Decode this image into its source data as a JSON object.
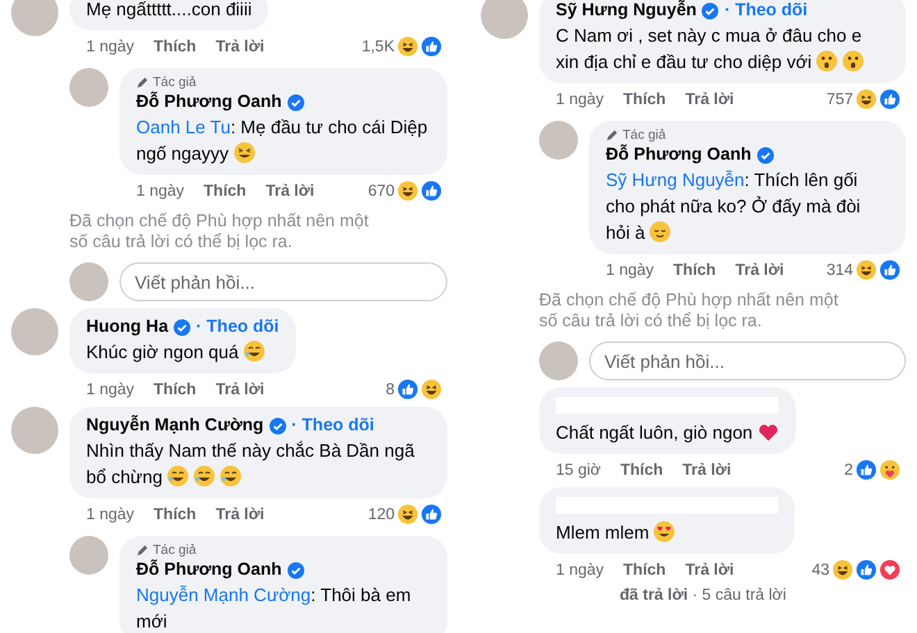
{
  "columns": [
    {
      "items": [
        {
          "kind": "comment",
          "avatar": true,
          "text": "Mẹ ngấttttt....con điiii",
          "time": "1 ngày",
          "like": "Thích",
          "reply": "Trả lời",
          "count": "1,5K",
          "reactions": [
            {
              "kind": "haha"
            },
            {
              "kind": "like"
            }
          ],
          "children": [
            {
              "kind": "comment",
              "avatar": true,
              "author_label": "Tác giả",
              "name": "Đỗ Phương Oanh",
              "verified": true,
              "mention": "Oanh Le Tu",
              "text": ": Mẹ đầu tư cho cái Diệp ngố ngayyy",
              "emojis": [
                {
                  "kind": "grin"
                }
              ],
              "time": "1 ngày",
              "like": "Thích",
              "reply": "Trả lời",
              "count": "670",
              "reactions": [
                {
                  "kind": "haha"
                },
                {
                  "kind": "like"
                }
              ]
            },
            {
              "kind": "filter_note",
              "text": "Đã chọn chế độ Phù hợp nhất nên một số câu trả lời có thể bị lọc ra."
            },
            {
              "kind": "reply_box",
              "placeholder": "Viết phản hồi..."
            }
          ]
        },
        {
          "kind": "comment",
          "avatar": true,
          "name": "Huong Ha",
          "verified": true,
          "follow": "· Theo dõi",
          "text": "Khúc giờ ngon quá",
          "emojis": [
            {
              "kind": "rofl"
            }
          ],
          "time": "1 ngày",
          "like": "Thích",
          "reply": "Trả lời",
          "count": "8",
          "reactions": [
            {
              "kind": "like"
            },
            {
              "kind": "haha"
            }
          ]
        },
        {
          "kind": "comment",
          "avatar": true,
          "name": "Nguyễn Mạnh Cường",
          "verified": true,
          "follow": "· Theo dõi",
          "text": "Nhìn thấy Nam thế này chắc Bà Dần ngã bổ chừng",
          "emojis": [
            {
              "kind": "rofl"
            },
            {
              "kind": "rofl"
            },
            {
              "kind": "rofl"
            }
          ],
          "time": "1 ngày",
          "like": "Thích",
          "reply": "Trả lời",
          "count": "120",
          "reactions": [
            {
              "kind": "haha"
            },
            {
              "kind": "like"
            }
          ],
          "children": [
            {
              "kind": "comment",
              "avatar": true,
              "author_label": "Tác giả",
              "name": "Đỗ Phương Oanh",
              "verified": true,
              "mention": "Nguyễn Mạnh Cường",
              "text": ": Thôi bà em mới"
            }
          ]
        }
      ]
    },
    {
      "items": [
        {
          "kind": "comment",
          "avatar": true,
          "name": "Sỹ Hưng Nguyễn",
          "verified": true,
          "follow": "· Theo dõi",
          "text": "C Nam ơi , set này c mua ở đâu cho e xin địa chỉ e đầu tư cho diệp với",
          "emojis": [
            {
              "kind": "astonished"
            },
            {
              "kind": "astonished"
            }
          ],
          "time": "1 ngày",
          "like": "Thích",
          "reply": "Trả lời",
          "count": "757",
          "reactions": [
            {
              "kind": "haha"
            },
            {
              "kind": "like"
            }
          ],
          "children": [
            {
              "kind": "comment",
              "avatar": true,
              "author_label": "Tác giả",
              "name": "Đỗ Phương Oanh",
              "verified": true,
              "mention": "Sỹ Hưng Nguyễn",
              "text": ": Thích lên gối cho phát nữa ko? Ở đấy mà đòi hỏi à",
              "emojis": [
                {
                  "kind": "relieved"
                }
              ],
              "time": "1 ngày",
              "like": "Thích",
              "reply": "Trả lời",
              "count": "314",
              "reactions": [
                {
                  "kind": "haha"
                },
                {
                  "kind": "like"
                }
              ]
            },
            {
              "kind": "filter_note",
              "text": "Đã chọn chế độ Phù hợp nhất nên một số câu trả lời có thể bị lọc ra."
            },
            {
              "kind": "reply_box",
              "placeholder": "Viết phản hồi..."
            }
          ]
        },
        {
          "kind": "comment",
          "avatar": false,
          "name_hidden": true,
          "text": "Chất ngất luôn, giò ngon",
          "emojis": [
            {
              "kind": "heart"
            }
          ],
          "time": "15 giờ",
          "like": "Thích",
          "reply": "Trả lời",
          "count": "2",
          "reactions": [
            {
              "kind": "like"
            },
            {
              "kind": "care"
            }
          ]
        },
        {
          "kind": "comment",
          "avatar": false,
          "name_hidden": true,
          "text": "Mlem mlem",
          "emojis": [
            {
              "kind": "heart_eyes"
            }
          ],
          "time": "1 ngày",
          "like": "Thích",
          "reply": "Trả lời",
          "count": "43",
          "reactions": [
            {
              "kind": "haha"
            },
            {
              "kind": "like"
            },
            {
              "kind": "love"
            }
          ]
        },
        {
          "kind": "more_replies",
          "text": "**đã trả lời** · 5 câu trả lời"
        }
      ]
    }
  ]
}
